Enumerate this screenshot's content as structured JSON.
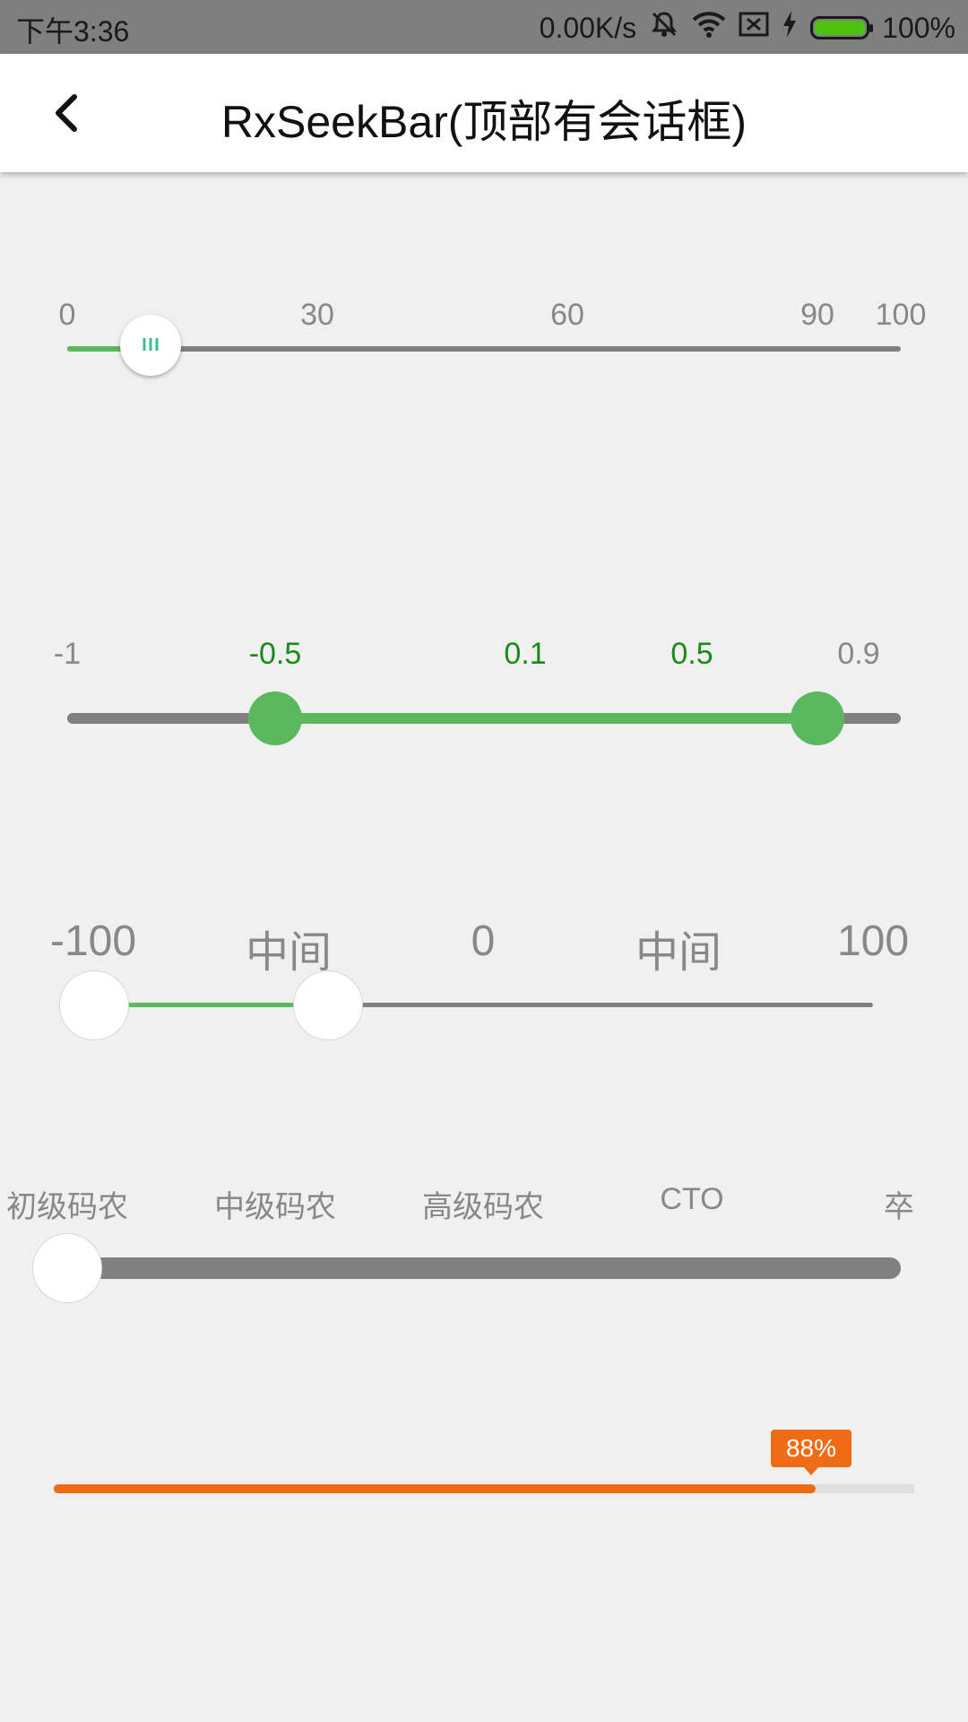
{
  "status_bar": {
    "time": "下午3:36",
    "network_speed": "0.00K/s",
    "battery": "100%",
    "icons": [
      "mute-icon",
      "wifi-icon",
      "sim-icon",
      "charging-icon",
      "battery-icon"
    ]
  },
  "header": {
    "title": "RxSeekBar(顶部有会话框)",
    "back_icon": "chevron-left-icon"
  },
  "slider1": {
    "ticks": [
      "0",
      "30",
      "60",
      "90",
      "100"
    ],
    "value": 10,
    "min": 0,
    "max": 100,
    "accent": "#5cb85c",
    "thumb_icon": "grip-lines-icon"
  },
  "slider2": {
    "ticks": [
      "-1",
      "-0.5",
      "0.1",
      "0.5",
      "0.9"
    ],
    "range_low": -0.5,
    "range_high": 0.8,
    "accent": "#5cb85c",
    "active_color": "#1a8a1a"
  },
  "slider3": {
    "ticks": [
      "-100",
      "中间",
      "0",
      "中间",
      "100"
    ],
    "range_low": -100,
    "range_high": -50
  },
  "slider4": {
    "ticks": [
      "初级码农",
      "中级码农",
      "高级码农",
      "CTO",
      "卒"
    ],
    "value_index": 0
  },
  "progress": {
    "label": "88%",
    "value": 0.88,
    "color": "#ef6b16",
    "track_color": "#dcdfe2"
  }
}
